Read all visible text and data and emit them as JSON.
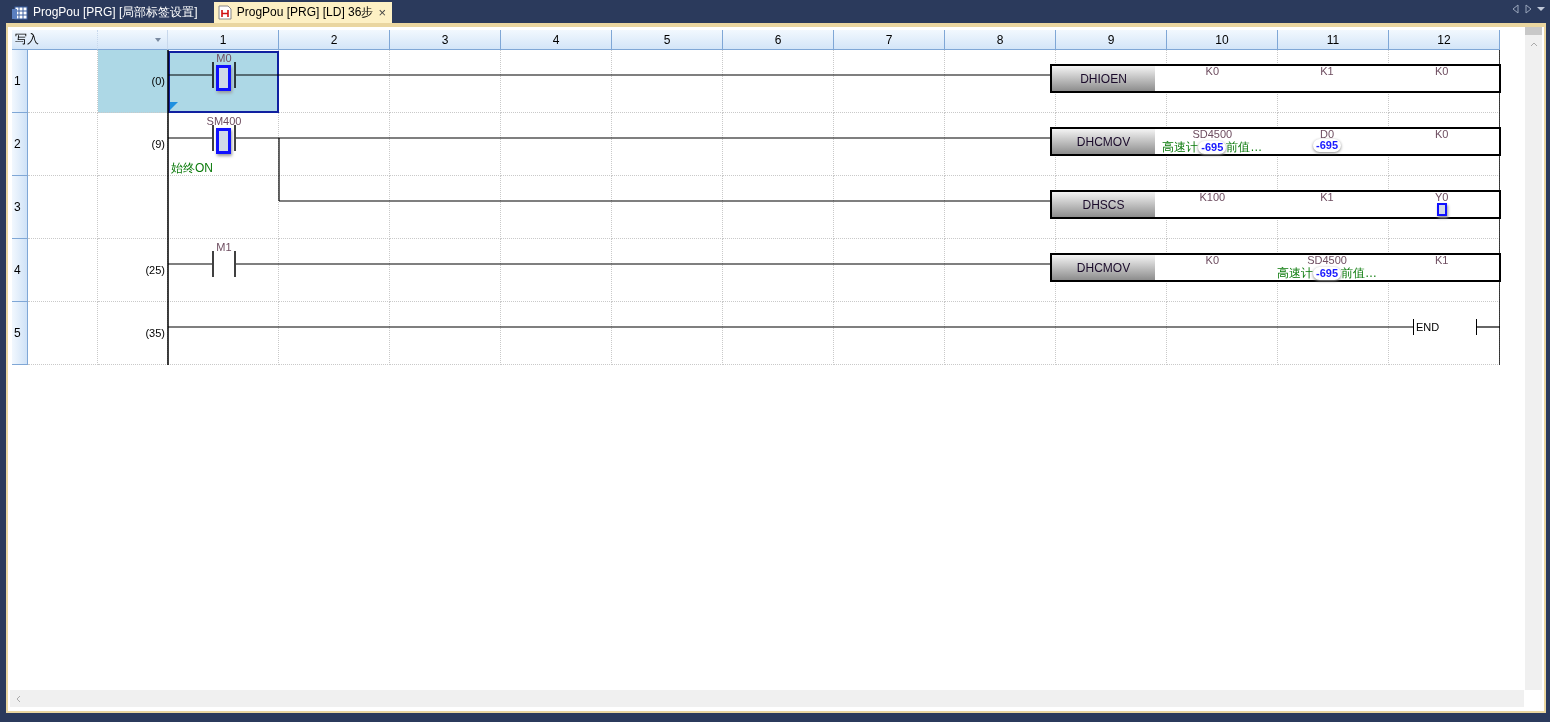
{
  "tabs": [
    {
      "label": "ProgPou [PRG] [局部标签设置]",
      "kind": "table",
      "selected": false,
      "closable": false
    },
    {
      "label": "ProgPou [PRG] [LD] 36步",
      "kind": "ladder",
      "selected": true,
      "closable": true,
      "close": "×"
    }
  ],
  "header": {
    "mode": "写入",
    "columns": [
      "1",
      "2",
      "3",
      "4",
      "5",
      "6",
      "7",
      "8",
      "9",
      "10",
      "11",
      "12"
    ]
  },
  "rungs": [
    {
      "number": "1",
      "step": "(0)",
      "selected": true,
      "contact": {
        "device": "M0",
        "on": true
      },
      "instruction": {
        "name": "DHIOEN",
        "operands": [
          {
            "device": "K0"
          },
          {
            "device": "K1"
          },
          {
            "device": "K0"
          }
        ]
      }
    },
    {
      "number": "2",
      "step": "(9)",
      "selected": false,
      "contact": {
        "device": "SM400",
        "on": true,
        "comment": "始终ON"
      },
      "instruction": {
        "name": "DHCMOV",
        "operands": [
          {
            "device": "SD4500",
            "comment_before": "高速计",
            "value": "-695",
            "comment_after": "前值…"
          },
          {
            "device": "D0",
            "value": "-695"
          },
          {
            "device": "K0"
          }
        ]
      },
      "branch": {
        "number": "3",
        "instruction": {
          "name": "DHSCS",
          "operands": [
            {
              "device": "K100"
            },
            {
              "device": "K1"
            },
            {
              "device": "Y0",
              "on": true
            }
          ]
        }
      }
    },
    {
      "number": "4",
      "step": "(25)",
      "selected": false,
      "contact": {
        "device": "M1",
        "on": false
      },
      "instruction": {
        "name": "DHCMOV",
        "operands": [
          {
            "device": "K0"
          },
          {
            "device": "SD4500",
            "comment_before": "高速计",
            "value": "-695",
            "comment_after": "前值…"
          },
          {
            "device": "K1"
          }
        ]
      }
    },
    {
      "number": "5",
      "step": "(35)",
      "selected": false,
      "end": "END"
    }
  ]
}
